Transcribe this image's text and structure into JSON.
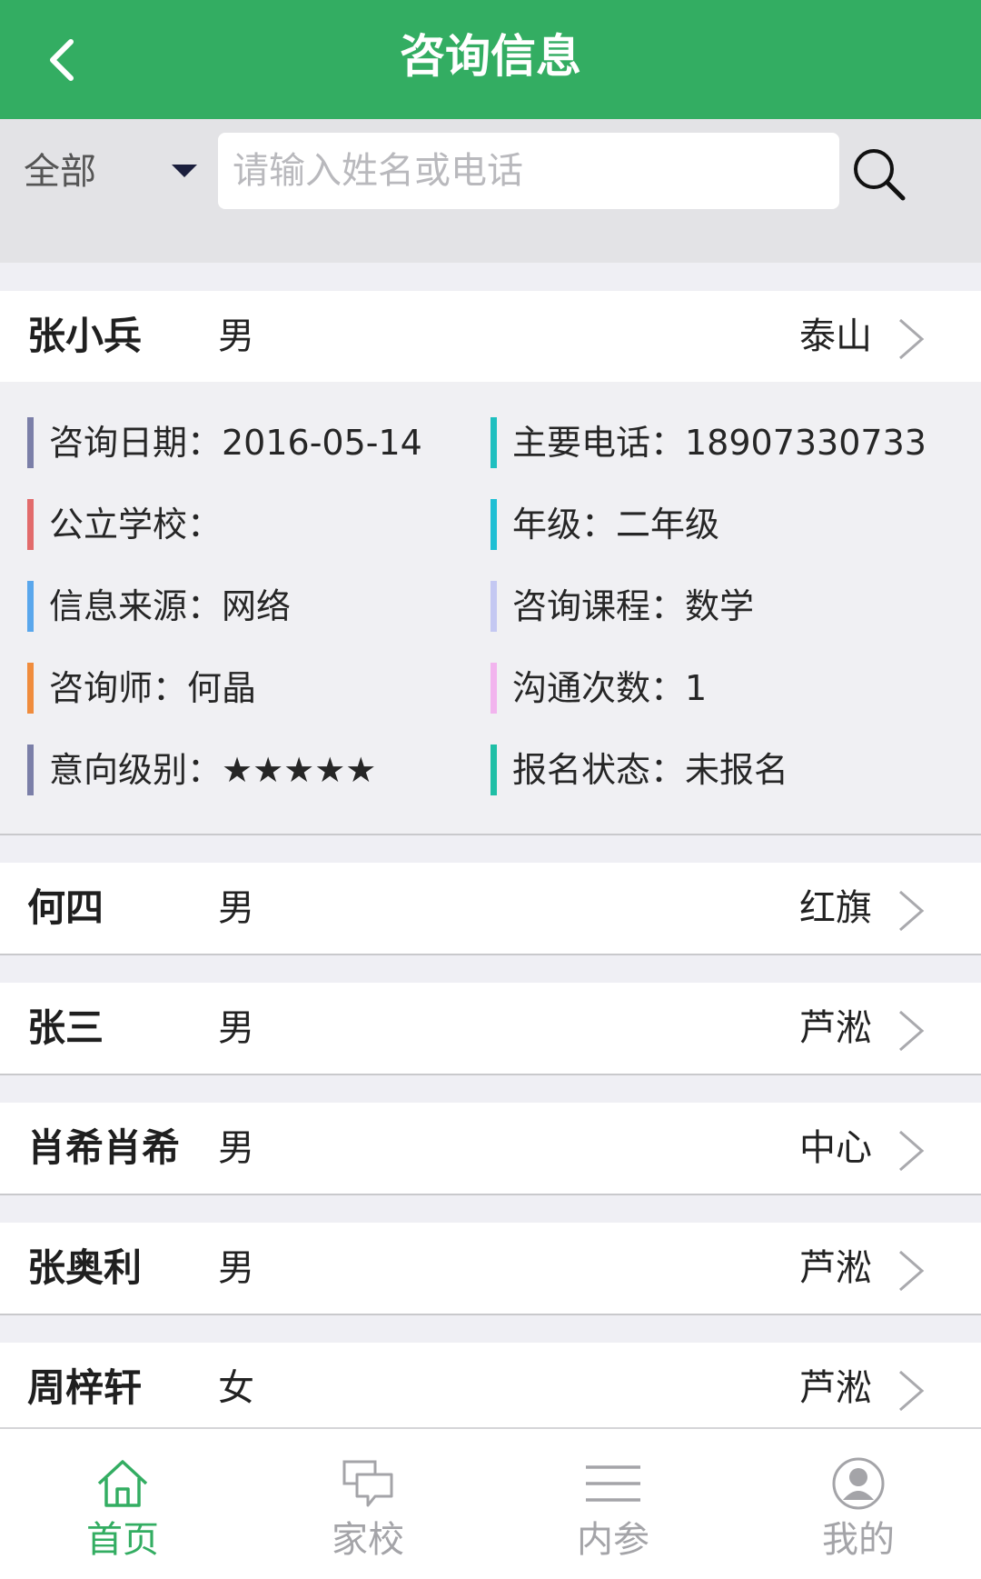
{
  "header": {
    "title": "咨询信息"
  },
  "search": {
    "filter_value": "全部",
    "placeholder": "请输入姓名或电话",
    "value": ""
  },
  "colors": {
    "brand_green": "#33ad62",
    "tab_active": "#33ad62",
    "tab_inactive": "#a4a4a8"
  },
  "records": [
    {
      "name": "张小兵",
      "gender": "男",
      "campus": "泰山",
      "expanded": true
    },
    {
      "name": "何四",
      "gender": "男",
      "campus": "红旗"
    },
    {
      "name": "张三",
      "gender": "男",
      "campus": "芦淞"
    },
    {
      "name": "肖希肖希",
      "gender": "男",
      "campus": "中心"
    },
    {
      "name": "张奥利",
      "gender": "男",
      "campus": "芦淞"
    },
    {
      "name": "周梓轩",
      "gender": "女",
      "campus": "芦淞"
    }
  ],
  "details": {
    "consult_date": {
      "text": "咨询日期：2016-05-14",
      "bar_color": "#7b7fa8"
    },
    "phone": {
      "text": "主要电话：18907330733",
      "bar_color": "#1fbfbf"
    },
    "public_school": {
      "text": "公立学校：",
      "bar_color": "#e26b6b"
    },
    "grade": {
      "text": "年级：二年级",
      "bar_color": "#1fbfd4"
    },
    "info_source": {
      "text": "信息来源：网络",
      "bar_color": "#5aa7ec"
    },
    "course": {
      "text": "咨询课程：数学",
      "bar_color": "#c4c8f2"
    },
    "counselor": {
      "text": "咨询师：何晶",
      "bar_color": "#f08c3c"
    },
    "contact_count": {
      "text": "沟通次数：1",
      "bar_color": "#f2b4ee"
    },
    "intent_level": {
      "text": "意向级别：★★★★★",
      "bar_color": "#7b7fa8"
    },
    "enroll_status": {
      "text": "报名状态：未报名",
      "bar_color": "#1fbfa6"
    }
  },
  "tabs": [
    {
      "label": "首页",
      "icon": "home-icon",
      "active": true
    },
    {
      "label": "家校",
      "icon": "chat-icon",
      "active": false
    },
    {
      "label": "内参",
      "icon": "menu-icon",
      "active": false
    },
    {
      "label": "我的",
      "icon": "user-icon",
      "active": false
    }
  ]
}
